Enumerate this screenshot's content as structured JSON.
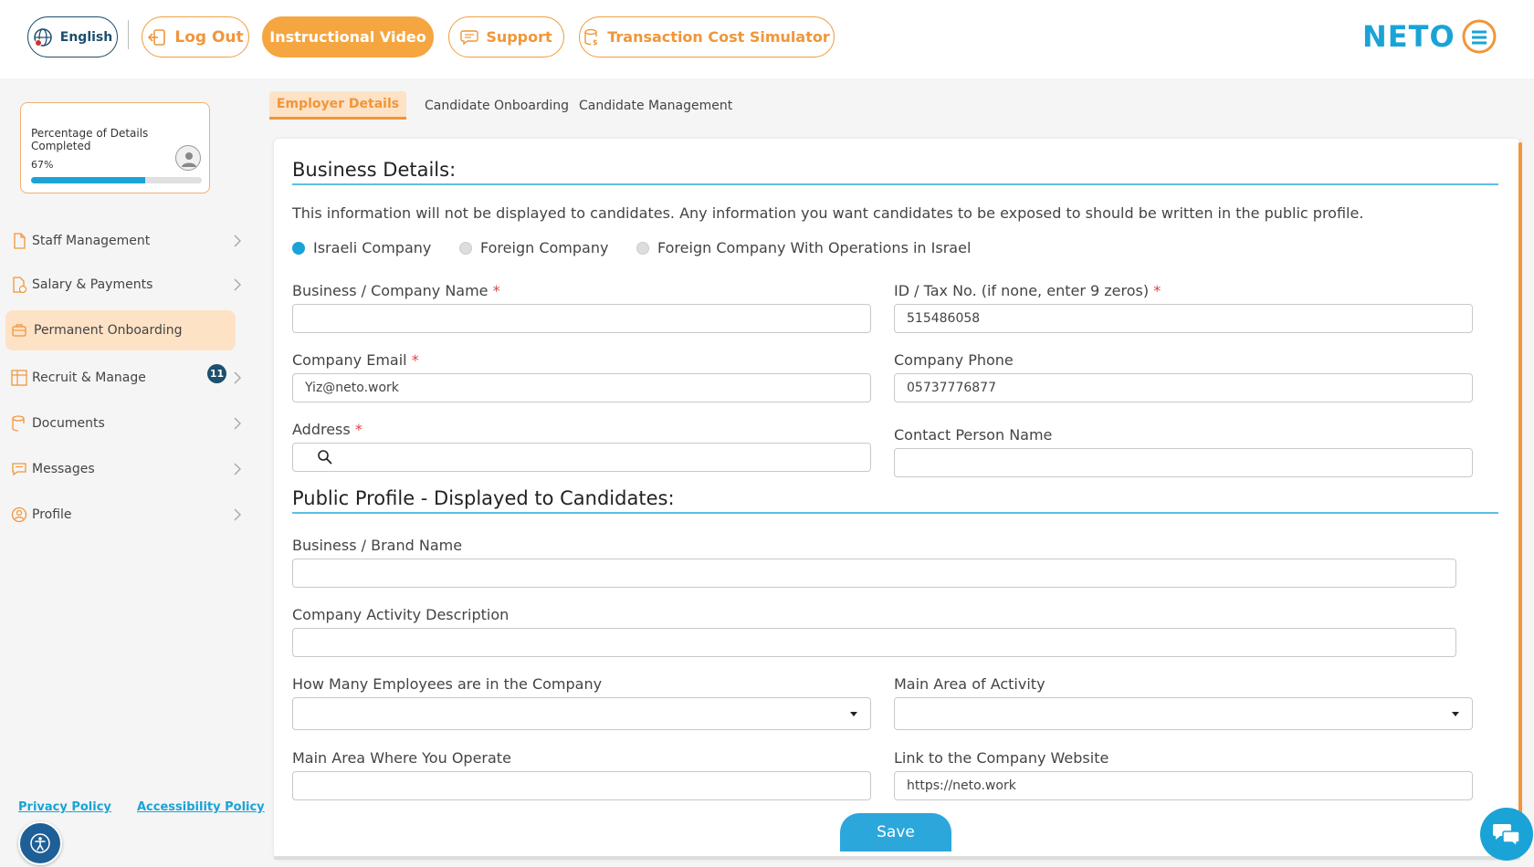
{
  "header": {
    "language_label": "English",
    "logout_label": "Log Out",
    "video_label": "Instructional Video",
    "support_label": "Support",
    "simulator_label": "Transaction Cost Simulator",
    "logo_text": "NETO"
  },
  "progress": {
    "title": "Percentage of Details Completed",
    "percent_label": "67%",
    "percent_value": 67
  },
  "sidebar": {
    "items": [
      {
        "label": "Staff Management",
        "icon": "file-icon"
      },
      {
        "label": "Salary & Payments",
        "icon": "file-coin-icon"
      },
      {
        "label": "Permanent Onboarding",
        "icon": "briefcase-icon",
        "active": true
      },
      {
        "label": "Recruit & Manage",
        "icon": "grid-add-icon",
        "badge": "11"
      },
      {
        "label": "Documents",
        "icon": "stack-icon"
      },
      {
        "label": "Messages",
        "icon": "chat-icon"
      },
      {
        "label": "Profile",
        "icon": "user-circle-icon"
      }
    ],
    "privacy_label": "Privacy Policy",
    "accessibility_label": "Accessibility Policy"
  },
  "tabs": [
    {
      "label": "Employer Details"
    },
    {
      "label": "Candidate Onboarding"
    },
    {
      "label": "Candidate Management"
    }
  ],
  "business": {
    "title": "Business Details:",
    "info": "This information will not be displayed to candidates. Any information you want candidates to be exposed to should be written in the public profile.",
    "company_types": [
      {
        "label": "Israeli Company",
        "checked": true
      },
      {
        "label": "Foreign Company",
        "checked": false
      },
      {
        "label": "Foreign Company With Operations in Israel",
        "checked": false
      }
    ],
    "name_label": "Business / Company Name",
    "name_value": "",
    "tax_label": "ID / Tax No. (if none, enter 9 zeros)",
    "tax_value": "515486058",
    "email_label": "Company Email",
    "email_value": "Yiz@neto.work",
    "phone_label": "Company Phone",
    "phone_value": "05737776877",
    "address_label": "Address",
    "address_value": "",
    "contact_label": "Contact Person Name",
    "contact_value": "",
    "required_mark": "*"
  },
  "public_profile": {
    "title": "Public Profile - Displayed to Candidates:",
    "brand_label": "Business / Brand Name",
    "brand_value": "",
    "activity_label": "Company Activity Description",
    "activity_value": "",
    "employees_label": "How Many Employees are in the Company",
    "employees_value": "",
    "area_activity_label": "Main Area of Activity",
    "area_activity_value": "",
    "operate_label": "Main Area Where You Operate",
    "operate_value": "",
    "website_label": "Link to the Company Website",
    "website_value": "https://neto.work"
  },
  "save_label": "Save",
  "colors": {
    "accent_orange": "#f5a641",
    "accent_blue": "#1aa3d6",
    "navy": "#1d4f6e"
  }
}
